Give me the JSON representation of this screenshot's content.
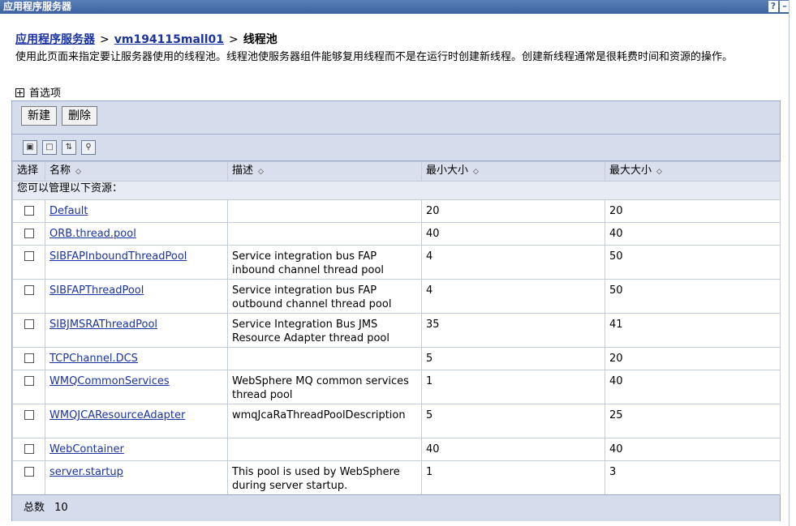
{
  "window": {
    "title": "应用程序服务器",
    "help_label": "?",
    "minimize_label": "–"
  },
  "breadcrumb": {
    "root": "应用程序服务器",
    "server": "vm194115mall01",
    "separator": ">",
    "current": "线程池"
  },
  "description": "使用此页面来指定要让服务器使用的线程池。线程池使服务器组件能够复用线程而不是在运行时创建新线程。创建新线程通常是很耗费时间和资源的操作。",
  "preferences": {
    "label": "首选项"
  },
  "toolbar": {
    "new_label": "新建",
    "delete_label": "删除"
  },
  "icons": [
    "select-all-icon",
    "deselect-all-icon",
    "show-filter-icon",
    "clear-filter-icon"
  ],
  "table": {
    "columns": {
      "select": "选择",
      "name": "名称",
      "desc": "描述",
      "min": "最小大小",
      "max": "最大大小"
    },
    "section_label": "您可以管理以下资源：",
    "rows": [
      {
        "name": "Default",
        "desc": "",
        "min": "20",
        "max": "20"
      },
      {
        "name": "ORB.thread.pool",
        "desc": "",
        "min": "40",
        "max": "40"
      },
      {
        "name": "SIBFAPInboundThreadPool",
        "desc": "Service integration bus FAP inbound channel thread pool",
        "min": "4",
        "max": "50"
      },
      {
        "name": "SIBFAPThreadPool",
        "desc": "Service integration bus FAP outbound channel thread pool",
        "min": "4",
        "max": "50"
      },
      {
        "name": "SIBJMSRAThreadPool",
        "desc": "Service Integration Bus JMS Resource Adapter thread pool",
        "min": "35",
        "max": "41"
      },
      {
        "name": "TCPChannel.DCS",
        "desc": "",
        "min": "5",
        "max": "20"
      },
      {
        "name": "WMQCommonServices",
        "desc": "WebSphere MQ common services thread pool",
        "min": "1",
        "max": "40"
      },
      {
        "name": "WMQJCAResourceAdapter",
        "desc": "wmqJcaRaThreadPoolDescription",
        "min": "5",
        "max": "25"
      },
      {
        "name": "WebContainer",
        "desc": "",
        "min": "40",
        "max": "40"
      },
      {
        "name": "server.startup",
        "desc": "This pool is used by WebSphere during server startup.",
        "min": "1",
        "max": "3"
      }
    ]
  },
  "footer": {
    "total_label": "总数",
    "total_value": "10"
  }
}
